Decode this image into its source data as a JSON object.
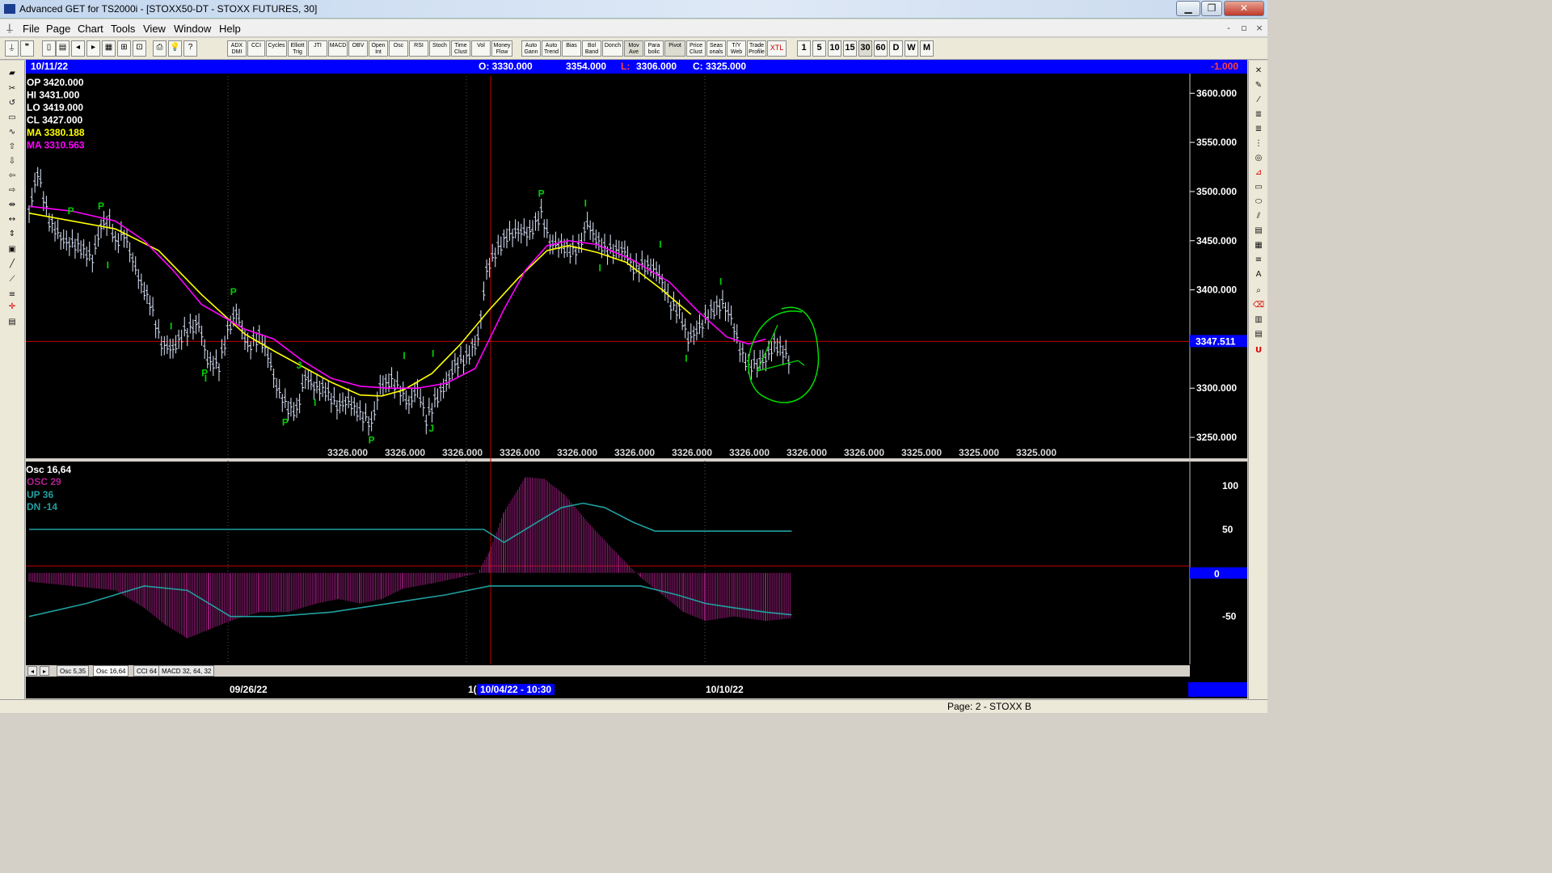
{
  "window": {
    "title": "Advanced GET for TS2000i - [STOXX50-DT - STOXX FUTURES, 30]",
    "minimize": "▁",
    "restore": "❐",
    "close": "✕"
  },
  "menu": [
    "File",
    "Page",
    "Chart",
    "Tools",
    "View",
    "Window",
    "Help"
  ],
  "mdi": {
    "minimize": "-",
    "restore": "▫",
    "close": "×"
  },
  "toolbar": {
    "indicators": [
      "ADX DMI",
      "CCI",
      "Cycles",
      "Elliott Trig",
      "JTI",
      "MACD",
      "OBV",
      "Open Int",
      "Osc",
      "RSI",
      "Stoch",
      "Time Clust",
      "Vol",
      "Money Flow"
    ],
    "studies": [
      "Auto Gann",
      "Auto Trend",
      "Bias",
      "Bol Band",
      "Donch",
      "Mov Ave",
      "Para bolic",
      "Pivot",
      "Price Clust",
      "Seas onals",
      "T/Y Web",
      "Trade Profile",
      "XTL"
    ],
    "intervals": [
      "1",
      "5",
      "10",
      "15",
      "30",
      "60",
      "D",
      "W",
      "M"
    ]
  },
  "info_bar": {
    "date": "10/11/22",
    "open": "O: 3330.000",
    "high": "3354.000",
    "low_label": "L:",
    "low": "3306.000",
    "close": "C: 3325.000",
    "change": "-1.000"
  },
  "legend": {
    "op": "OP  3420.000",
    "hi": "HI   3431.000",
    "lo": "LO   3419.000",
    "cl": "CL   3427.000",
    "ma1": "MA  3380.188",
    "ma2": "MA  3310.563"
  },
  "colors": {
    "ma_fast": "#ffff00",
    "ma_slow": "#ff00ff",
    "osc": "#b0208e",
    "trend": "#20a0a0",
    "pivot_label": "#00d000",
    "circle": "#00e000"
  },
  "price_axis": {
    "ticks": [
      3600,
      3550,
      3500,
      3450,
      3400,
      3300,
      3250
    ],
    "tick_labels": [
      "3600.000",
      "3550.000",
      "3500.000",
      "3450.000",
      "3400.000",
      "3300.000",
      "3250.000"
    ],
    "current": "3347.511",
    "current_value": 3347.511,
    "min": 3227,
    "max": 3620
  },
  "bottom_values": [
    "3326.000",
    "3326.000",
    "3326.000",
    "3326.000",
    "3326.000",
    "3326.000",
    "3326.000",
    "3326.000",
    "3326.000",
    "3326.000",
    "3325.000",
    "3325.000",
    "3325.000"
  ],
  "oscillator": {
    "title": "Osc 16,64",
    "osc": "OSC 29",
    "up": "UP   36",
    "dn": "DN   -14",
    "ticks": [
      "100",
      "50",
      "-50"
    ],
    "zero": "0"
  },
  "tabs": [
    "Osc 5,35",
    "Osc 16,64",
    "CCI 64",
    "MACD 32, 64, 32"
  ],
  "dates": {
    "d1": "09/26/22",
    "d2": "1(",
    "d3": "10/04/22 - 10:30",
    "d4": "10/10/22"
  },
  "status": "Page: 2 - STOXX B",
  "chart_data": {
    "type": "line",
    "price_series": [
      [
        0,
        3480
      ],
      [
        6,
        3520
      ],
      [
        14,
        3470
      ],
      [
        24,
        3450
      ],
      [
        34,
        3445
      ],
      [
        44,
        3432
      ],
      [
        50,
        3465
      ],
      [
        56,
        3470
      ],
      [
        60,
        3448
      ],
      [
        66,
        3458
      ],
      [
        72,
        3430
      ],
      [
        78,
        3405
      ],
      [
        84,
        3388
      ],
      [
        92,
        3345
      ],
      [
        100,
        3340
      ],
      [
        108,
        3357
      ],
      [
        118,
        3366
      ],
      [
        124,
        3328
      ],
      [
        132,
        3323
      ],
      [
        138,
        3358
      ],
      [
        144,
        3378
      ],
      [
        152,
        3342
      ],
      [
        160,
        3353
      ],
      [
        166,
        3334
      ],
      [
        172,
        3301
      ],
      [
        180,
        3280
      ],
      [
        186,
        3277
      ],
      [
        192,
        3312
      ],
      [
        198,
        3302
      ],
      [
        206,
        3298
      ],
      [
        214,
        3282
      ],
      [
        222,
        3287
      ],
      [
        230,
        3274
      ],
      [
        238,
        3264
      ],
      [
        244,
        3302
      ],
      [
        252,
        3308
      ],
      [
        258,
        3298
      ],
      [
        264,
        3284
      ],
      [
        270,
        3301
      ],
      [
        276,
        3268
      ],
      [
        282,
        3287
      ],
      [
        290,
        3305
      ],
      [
        296,
        3324
      ],
      [
        304,
        3331
      ],
      [
        312,
        3350
      ],
      [
        318,
        3420
      ],
      [
        324,
        3438
      ],
      [
        332,
        3455
      ],
      [
        340,
        3460
      ],
      [
        348,
        3458
      ],
      [
        356,
        3478
      ],
      [
        362,
        3448
      ],
      [
        370,
        3445
      ],
      [
        376,
        3440
      ],
      [
        382,
        3442
      ],
      [
        388,
        3468
      ],
      [
        394,
        3452
      ],
      [
        400,
        3442
      ],
      [
        406,
        3440
      ],
      [
        414,
        3440
      ],
      [
        420,
        3422
      ],
      [
        428,
        3425
      ],
      [
        436,
        3420
      ],
      [
        440,
        3408
      ],
      [
        446,
        3385
      ],
      [
        452,
        3378
      ],
      [
        458,
        3350
      ],
      [
        466,
        3362
      ],
      [
        474,
        3378
      ],
      [
        482,
        3386
      ],
      [
        488,
        3372
      ],
      [
        494,
        3340
      ],
      [
        500,
        3322
      ],
      [
        506,
        3325
      ],
      [
        512,
        3330
      ],
      [
        518,
        3345
      ],
      [
        524,
        3338
      ],
      [
        530,
        3325
      ]
    ],
    "ma_fast": [
      [
        0,
        3478
      ],
      [
        30,
        3470
      ],
      [
        60,
        3462
      ],
      [
        90,
        3440
      ],
      [
        120,
        3395
      ],
      [
        150,
        3355
      ],
      [
        170,
        3338
      ],
      [
        190,
        3322
      ],
      [
        210,
        3306
      ],
      [
        230,
        3293
      ],
      [
        245,
        3292
      ],
      [
        260,
        3298
      ],
      [
        280,
        3315
      ],
      [
        300,
        3345
      ],
      [
        320,
        3380
      ],
      [
        340,
        3412
      ],
      [
        360,
        3440
      ],
      [
        375,
        3445
      ],
      [
        395,
        3438
      ],
      [
        415,
        3428
      ],
      [
        440,
        3400
      ],
      [
        460,
        3375
      ]
    ],
    "ma_slow": [
      [
        0,
        3485
      ],
      [
        30,
        3480
      ],
      [
        60,
        3470
      ],
      [
        80,
        3450
      ],
      [
        100,
        3420
      ],
      [
        120,
        3385
      ],
      [
        150,
        3360
      ],
      [
        170,
        3350
      ],
      [
        190,
        3328
      ],
      [
        210,
        3310
      ],
      [
        230,
        3302
      ],
      [
        250,
        3300
      ],
      [
        270,
        3300
      ],
      [
        290,
        3305
      ],
      [
        310,
        3320
      ],
      [
        330,
        3380
      ],
      [
        345,
        3420
      ],
      [
        360,
        3445
      ],
      [
        375,
        3450
      ],
      [
        395,
        3446
      ],
      [
        420,
        3430
      ],
      [
        445,
        3408
      ],
      [
        465,
        3378
      ],
      [
        485,
        3352
      ],
      [
        500,
        3345
      ],
      [
        512,
        3350
      ]
    ],
    "pivots": [
      {
        "t": 29,
        "v": 3462,
        "l": "P",
        "dir": "up"
      },
      {
        "t": 50,
        "v": 3467,
        "l": "P",
        "dir": "up"
      },
      {
        "t": 56,
        "v": 3440,
        "l": "I",
        "dir": "down"
      },
      {
        "t": 100,
        "v": 3345,
        "l": "I",
        "dir": "up"
      },
      {
        "t": 122,
        "v": 3330,
        "l": "P",
        "dir": "down"
      },
      {
        "t": 124,
        "v": 3325,
        "l": "I",
        "dir": "down"
      },
      {
        "t": 142,
        "v": 3380,
        "l": "P",
        "dir": "up"
      },
      {
        "t": 188,
        "v": 3305,
        "l": "J",
        "dir": "up"
      },
      {
        "t": 178,
        "v": 3280,
        "l": "P",
        "dir": "down"
      },
      {
        "t": 200,
        "v": 3300,
        "l": "I",
        "dir": "down"
      },
      {
        "t": 238,
        "v": 3262,
        "l": "P",
        "dir": "down"
      },
      {
        "t": 262,
        "v": 3315,
        "l": "I",
        "dir": "up"
      },
      {
        "t": 282,
        "v": 3317,
        "l": "I",
        "dir": "up"
      },
      {
        "t": 280,
        "v": 3274,
        "l": "J",
        "dir": "down"
      },
      {
        "t": 356,
        "v": 3480,
        "l": "P",
        "dir": "up"
      },
      {
        "t": 388,
        "v": 3470,
        "l": "I",
        "dir": "up"
      },
      {
        "t": 398,
        "v": 3437,
        "l": "I",
        "dir": "down"
      },
      {
        "t": 440,
        "v": 3428,
        "l": "I",
        "dir": "up"
      },
      {
        "t": 458,
        "v": 3345,
        "l": "I",
        "dir": "down"
      },
      {
        "t": 482,
        "v": 3390,
        "l": "I",
        "dir": "up"
      }
    ],
    "oscillator_values": [
      [
        0,
        -10
      ],
      [
        30,
        -15
      ],
      [
        60,
        -20
      ],
      [
        80,
        -40
      ],
      [
        95,
        -60
      ],
      [
        110,
        -75
      ],
      [
        125,
        -65
      ],
      [
        140,
        -55
      ],
      [
        160,
        -45
      ],
      [
        180,
        -45
      ],
      [
        200,
        -35
      ],
      [
        215,
        -30
      ],
      [
        230,
        -35
      ],
      [
        245,
        -30
      ],
      [
        260,
        -18
      ],
      [
        280,
        -12
      ],
      [
        300,
        -5
      ],
      [
        312,
        0
      ],
      [
        320,
        25
      ],
      [
        330,
        70
      ],
      [
        345,
        110
      ],
      [
        358,
        108
      ],
      [
        372,
        90
      ],
      [
        390,
        55
      ],
      [
        410,
        20
      ],
      [
        425,
        -5
      ],
      [
        440,
        -25
      ],
      [
        455,
        -45
      ],
      [
        470,
        -55
      ],
      [
        490,
        -50
      ],
      [
        512,
        -55
      ],
      [
        530,
        -52
      ]
    ],
    "trend_values": [
      [
        0,
        -50
      ],
      [
        40,
        -35
      ],
      [
        80,
        -15
      ],
      [
        110,
        -20
      ],
      [
        140,
        -50
      ],
      [
        170,
        -50
      ],
      [
        210,
        -45
      ],
      [
        250,
        -35
      ],
      [
        290,
        -25
      ],
      [
        320,
        -15
      ],
      [
        330,
        -15
      ],
      [
        390,
        -15
      ],
      [
        410,
        -15
      ],
      [
        425,
        -15
      ],
      [
        450,
        -25
      ],
      [
        470,
        -35
      ],
      [
        490,
        -40
      ],
      [
        512,
        -45
      ],
      [
        530,
        -48
      ]
    ],
    "upper_band": [
      [
        0,
        50
      ],
      [
        316,
        50
      ],
      [
        330,
        35
      ],
      [
        350,
        55
      ],
      [
        370,
        75
      ],
      [
        385,
        80
      ],
      [
        400,
        75
      ],
      [
        420,
        58
      ],
      [
        435,
        48
      ],
      [
        512,
        48
      ],
      [
        530,
        48
      ]
    ],
    "osc_ylim": [
      -105,
      125
    ],
    "t_max": 530,
    "cursor_t": 318
  }
}
